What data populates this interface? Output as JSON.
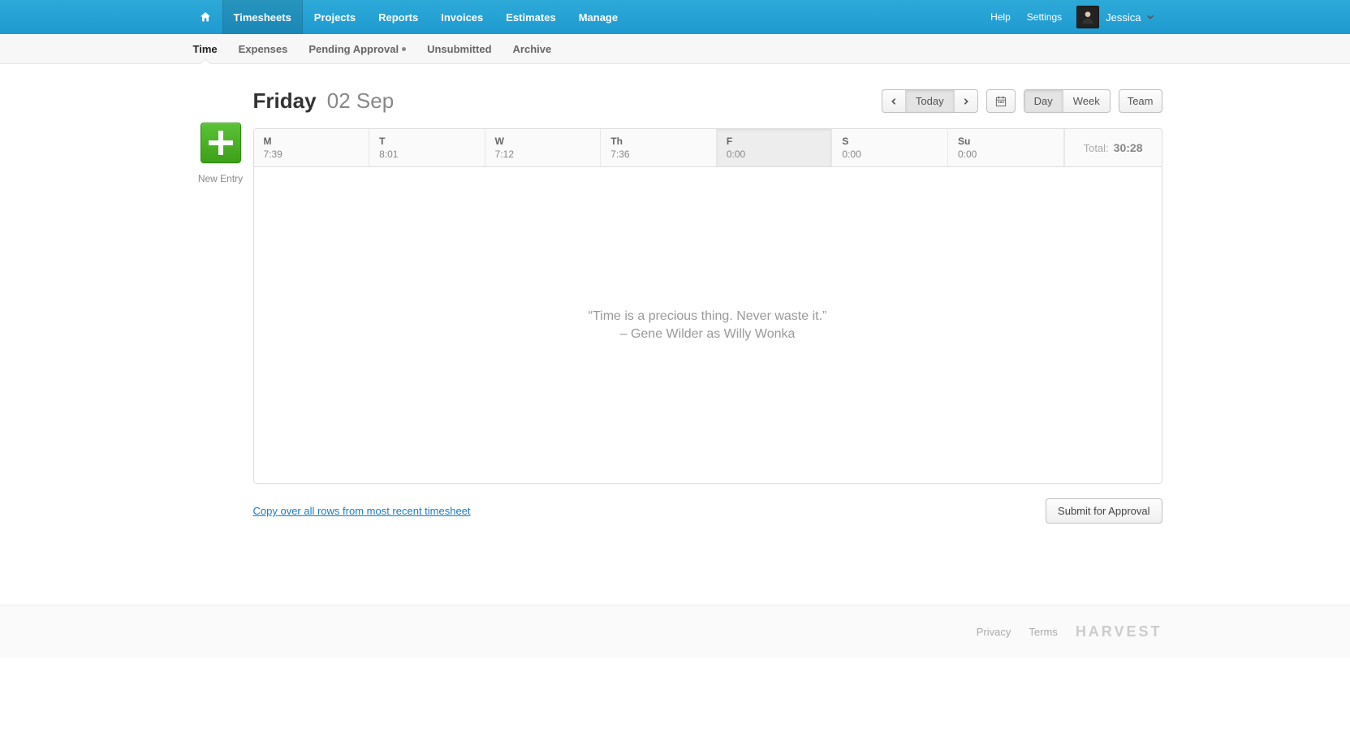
{
  "topnav": {
    "items": [
      "Timesheets",
      "Projects",
      "Reports",
      "Invoices",
      "Estimates",
      "Manage"
    ],
    "active_index": 0,
    "help": "Help",
    "settings": "Settings",
    "user_name": "Jessica"
  },
  "subnav": {
    "items": [
      {
        "label": "Time",
        "active": true,
        "has_dot": false
      },
      {
        "label": "Expenses",
        "active": false,
        "has_dot": false
      },
      {
        "label": "Pending Approval",
        "active": false,
        "has_dot": true
      },
      {
        "label": "Unsubmitted",
        "active": false,
        "has_dot": false
      },
      {
        "label": "Archive",
        "active": false,
        "has_dot": false
      }
    ]
  },
  "side": {
    "new_entry_label": "New Entry"
  },
  "header": {
    "day_name": "Friday",
    "date_text": "02 Sep",
    "today_label": "Today",
    "view_day": "Day",
    "view_week": "Week",
    "team_label": "Team"
  },
  "week": {
    "days": [
      {
        "short": "M",
        "time": "7:39"
      },
      {
        "short": "T",
        "time": "8:01"
      },
      {
        "short": "W",
        "time": "7:12"
      },
      {
        "short": "Th",
        "time": "7:36"
      },
      {
        "short": "F",
        "time": "0:00"
      },
      {
        "short": "S",
        "time": "0:00"
      },
      {
        "short": "Su",
        "time": "0:00"
      }
    ],
    "active_index": 4,
    "total_label": "Total:",
    "total_value": "30:28"
  },
  "empty": {
    "quote": "“Time is a precious thing. Never waste it.”",
    "attribution": "– Gene Wilder as Willy Wonka"
  },
  "below": {
    "copy_link": "Copy over all rows from most recent timesheet",
    "submit_label": "Submit for Approval"
  },
  "footer": {
    "privacy": "Privacy",
    "terms": "Terms",
    "brand": "HARVEST"
  }
}
